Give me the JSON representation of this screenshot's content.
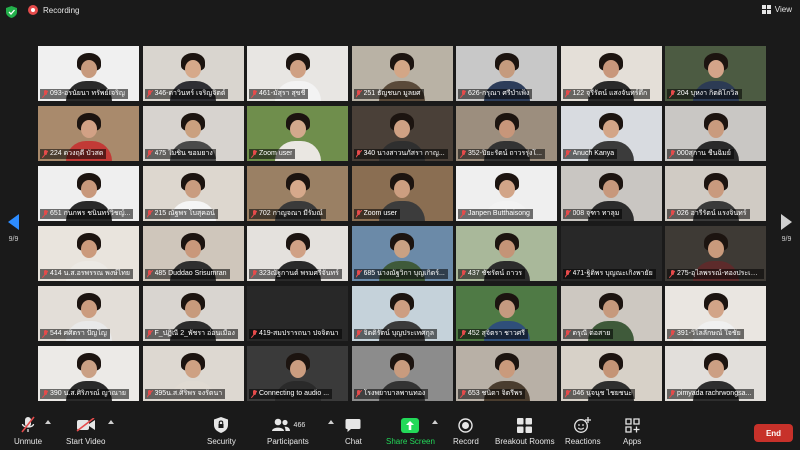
{
  "top": {
    "recording_label": "Recording",
    "view_label": "View"
  },
  "pagination": {
    "left": "9/9",
    "right": "9/9"
  },
  "participants": [
    {
      "name": "093-อรนัยนา    ทรัพย์เจริญ",
      "bg": "#f0f0f0",
      "skin": "#c79a7d",
      "body": "#2b2b2b"
    },
    {
      "name": "346-ดาวินทร์ เจริญจิตต์",
      "bg": "#d9d5cf",
      "skin": "#d6a98a",
      "body": "#2f2f34"
    },
    {
      "name": "461-มัสุรา สุขชี",
      "bg": "#e8e6e3",
      "skin": "#cfa083",
      "body": "#f3f3f3"
    },
    {
      "name": "251 ธัญชนก มูลยศ",
      "bg": "#b9b2a5",
      "skin": "#d3a686",
      "body": "#5a4a3a"
    },
    {
      "name": "626-กรุณา ศรีบำเพ็ง",
      "bg": "#c8c8c8",
      "skin": "#c59b7e",
      "body": "#2d3d5a"
    },
    {
      "name": "122 จุรีรัตน์ แสงจันทร์ดึก",
      "bg": "#e4dfd8",
      "skin": "#c8977b",
      "body": "#2a2a2a"
    },
    {
      "name": "204 บุหงา กิตติโกวิล",
      "bg": "#4c5b42",
      "skin": "#d4a489",
      "body": "#2c3b54"
    },
    {
      "name": "224 ดวงฤดี  บัวสด",
      "bg": "#a98a6c",
      "skin": "#d2a185",
      "body": "#c23a36"
    },
    {
      "name": "475 ไมชิน ขอมยาง",
      "bg": "#d7d3cf",
      "skin": "#caa07f",
      "body": "#4a4a4a"
    },
    {
      "name": "Zoom user",
      "bg": "#6f8e4c",
      "skin": "#d3a98c",
      "body": "#eae7e2"
    },
    {
      "name": "340 นางสาวนภัสรา  กาญ...",
      "bg": "#4a4038",
      "skin": "#cfa184",
      "body": "#2f2f2f"
    },
    {
      "name": "352-ปิยะรัตน์ ถาวรรุ่งโ...",
      "bg": "#9c8e7e",
      "skin": "#c7967a",
      "body": "#333"
    },
    {
      "name": "Anuch Kanya",
      "bg": "#d8dbe0",
      "skin": "#d3a587",
      "body": "#3b3b3b"
    },
    {
      "name": "000สุกาน  ชื่นฉิมย์",
      "bg": "#c9c7c4",
      "skin": "#c99b7e",
      "body": "#2a2a2a"
    },
    {
      "name": "651 กนกพร ชนินทร์วิชญ์...",
      "bg": "#efefef",
      "skin": "#c8987b",
      "body": "#2a2a2a"
    },
    {
      "name": "215 ณัฐพร โบสุคอน์",
      "bg": "#ddd7cf",
      "skin": "#c99c7f",
      "body": "#f5f5f5"
    },
    {
      "name": "702 กาญจณา  มีรัมณ์",
      "bg": "#9a8064",
      "skin": "#d6a98b",
      "body": "#3a3a3a"
    },
    {
      "name": "Zoom user",
      "bg": "#8a6e52",
      "skin": "#cc9e80",
      "body": "#3c3c3c"
    },
    {
      "name": "Janpen Butthaisong",
      "bg": "#efefef",
      "skin": "#d2a588",
      "body": "#f2f2f2"
    },
    {
      "name": "008 จุฑา ทาลุม",
      "bg": "#c9c6c2",
      "skin": "#c7987c",
      "body": "#2c2c2c"
    },
    {
      "name": "026 อารีรัตน์ แรงจินทร์",
      "bg": "#d0cbc4",
      "skin": "#c99a7e",
      "body": "#3a3a3a"
    },
    {
      "name": "414 น.ส.อรพรรณ พงษ์ไทย",
      "bg": "#e9e4dd",
      "skin": "#cb9a7c",
      "body": "#ece9e4"
    },
    {
      "name": "485 Duddao Srisumran",
      "bg": "#cfc6bb",
      "skin": "#c9987b",
      "body": "#2f2f2f"
    },
    {
      "name": "323ณัฐกานต์ พรมศรีจันทร์",
      "bg": "#e4e1dd",
      "skin": "#d0a185",
      "body": "#2a2a2a"
    },
    {
      "name": "685 นางณัฐวิกา บุญเกิดร์...",
      "bg": "#6b8aa8",
      "skin": "#c9a183",
      "body": "#3f5a3a"
    },
    {
      "name": "437 ชัชรัตน์ ถาวร",
      "bg": "#a9b89a",
      "skin": "#c49477",
      "body": "#2c2c2c"
    },
    {
      "name": "471-ฐิติพร บุญณะเกิงพายัย",
      "bg": "#282828",
      "skin": "#282828",
      "body": "#282828"
    },
    {
      "name": "275-อุไลพรรณ์-ทองประเสรฐ",
      "bg": "#3e3a35",
      "skin": "#c99a7c",
      "body": "#5d2b2b"
    },
    {
      "name": "544 ศศิตรา  ปัญโญ",
      "bg": "#e3ded8",
      "skin": "#cb9c7f",
      "body": "#e9e9e9"
    },
    {
      "name": "F_ปฏิณี 2_พัชรา  อ่อนเมือง",
      "bg": "#d9d5d0",
      "skin": "#c79a7c",
      "body": "#2d2d2d"
    },
    {
      "name": "419-สมปรารถนา ปจจิตนา",
      "bg": "#282828",
      "skin": "#282828",
      "body": "#282828"
    },
    {
      "name": "จิตติรัตน์ บุญประเทศกุล",
      "bg": "#c5d2da",
      "skin": "#cd9e82",
      "body": "#3a3a3a"
    },
    {
      "name": "452 สุจิตรา ชาวศรี",
      "bg": "#4f7a45",
      "skin": "#c59a80",
      "body": "#2f4f7a"
    },
    {
      "name": "ดรุณี ต่อสาย",
      "bg": "#cdc8c1",
      "skin": "#c6997c",
      "body": "#3f5a3a"
    },
    {
      "name": "391-วิไลลักษณ์   ใจชัย",
      "bg": "#eae6e1",
      "skin": "#d2a488",
      "body": "#f0f0f0"
    },
    {
      "name": "390 น.ส.ศิริภรณ์ ญาณาย",
      "bg": "#eceae7",
      "skin": "#caa084",
      "body": "#2a2a2a"
    },
    {
      "name": "395น.ส.ศิริพร จงรัตนา",
      "bg": "#ddd8d1",
      "skin": "#cea183",
      "body": "#e0dad2"
    },
    {
      "name": "Connecting to audio ...",
      "bg": "#3a3a3a",
      "skin": "#cb9d80",
      "body": "#2a2a2a"
    },
    {
      "name": "โรงพยาบาลพานทอง",
      "bg": "#8c8c8c",
      "skin": "#c89b7e",
      "body": "#333"
    },
    {
      "name": "653 ชนิดา จิตรีพร",
      "bg": "#b8b0a6",
      "skin": "#c99a7c",
      "body": "#4a3d2f"
    },
    {
      "name": "046 นุจนุช  ไชยชนะ",
      "bg": "#d7d1c8",
      "skin": "#c49476",
      "body": "#2f2f2f"
    },
    {
      "name": "pimyada rachrwongsa...",
      "bg": "#e2dfdb",
      "skin": "#cc9f83",
      "body": "#2e2e2e"
    }
  ],
  "toolbar": {
    "unmute": "Unmute",
    "start_video": "Start Video",
    "security": "Security",
    "participants": "Participants",
    "participant_count": "466",
    "chat": "Chat",
    "share_screen": "Share Screen",
    "record": "Record",
    "breakout_rooms": "Breakout Rooms",
    "reactions": "Reactions",
    "apps": "Apps",
    "end": "End"
  },
  "colors": {
    "accent": "#2d8cff",
    "share": "#23d959",
    "end": "#c7312a",
    "muted": "#e54b4b"
  }
}
